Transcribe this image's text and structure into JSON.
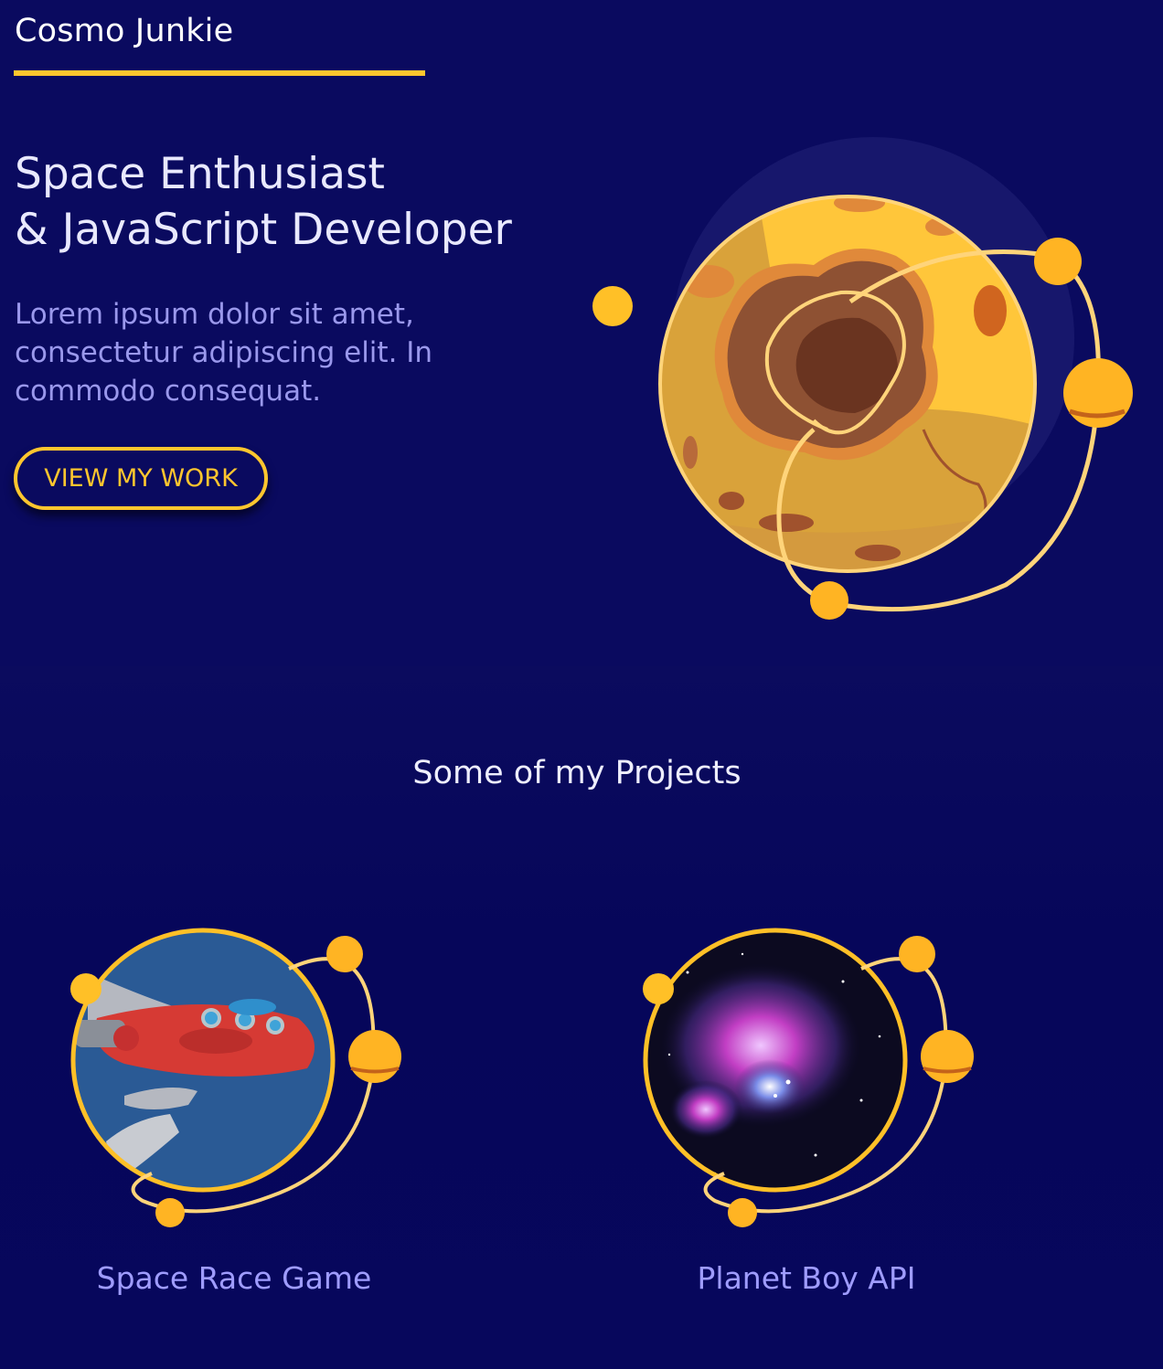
{
  "header": {
    "logo_text": "Cosmo Junkie"
  },
  "hero": {
    "headline_line1": "Space Enthusiast",
    "headline_line2": "& JavaScript Developer",
    "tagline": "Lorem ipsum dolor sit amet, consectetur adipiscing elit. In commodo consequat.",
    "cta_label": "VIEW MY WORK",
    "illustration": "planet-with-orbiting-moons"
  },
  "projects": {
    "title": "Some of my Projects",
    "items": [
      {
        "label": "Space Race Game",
        "image": "red-retro-rocket"
      },
      {
        "label": "Planet Boy API",
        "image": "purple-nebula"
      }
    ]
  },
  "colors": {
    "background": "#0a0a5f",
    "accent": "#ffc62e",
    "heading_text": "#e9e9ff",
    "muted_text": "#9a98ec",
    "project_label": "#9f9cff"
  }
}
